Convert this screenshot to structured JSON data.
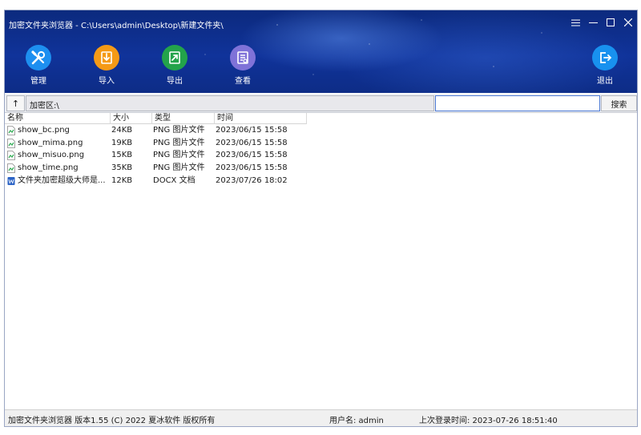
{
  "window": {
    "title": "加密文件夹浏览器 - C:\\Users\\admin\\Desktop\\新建文件夹\\"
  },
  "toolbar": {
    "items": [
      {
        "label": "管理",
        "icon": "tools-icon",
        "color": "#1d8ff0"
      },
      {
        "label": "导入",
        "icon": "import-icon",
        "color": "#f59a16"
      },
      {
        "label": "导出",
        "icon": "export-icon",
        "color": "#23a34b"
      },
      {
        "label": "查看",
        "icon": "view-document-icon",
        "color": "#7f72d8"
      }
    ],
    "exit": {
      "label": "退出",
      "icon": "exit-icon",
      "color": "#1891ef"
    }
  },
  "address": {
    "up_label": "↑",
    "path": "加密区:\\",
    "search_value": "",
    "search_button": "搜索"
  },
  "file_list": {
    "columns": [
      "名称",
      "大小",
      "类型",
      "时间"
    ],
    "rows": [
      {
        "name": "show_bc.png",
        "size": "24KB",
        "type": "PNG 图片文件",
        "time": "2023/06/15 15:58",
        "icon": "png-file-icon"
      },
      {
        "name": "show_mima.png",
        "size": "19KB",
        "type": "PNG 图片文件",
        "time": "2023/06/15 15:58",
        "icon": "png-file-icon"
      },
      {
        "name": "show_misuo.png",
        "size": "15KB",
        "type": "PNG 图片文件",
        "time": "2023/06/15 15:58",
        "icon": "png-file-icon"
      },
      {
        "name": "show_time.png",
        "size": "35KB",
        "type": "PNG 图片文件",
        "time": "2023/06/15 15:58",
        "icon": "png-file-icon"
      },
      {
        "name": "文件夹加密超级大师是...",
        "size": "12KB",
        "type": "DOCX 文档",
        "time": "2023/07/26 18:02",
        "icon": "word-file-icon"
      }
    ]
  },
  "status": {
    "app_info": "加密文件夹浏览器  版本1.55  (C) 2022 夏冰软件 版权所有",
    "user": "用户名:  admin",
    "last_login": "上次登录时间:  2023-07-26 18:51:40"
  }
}
